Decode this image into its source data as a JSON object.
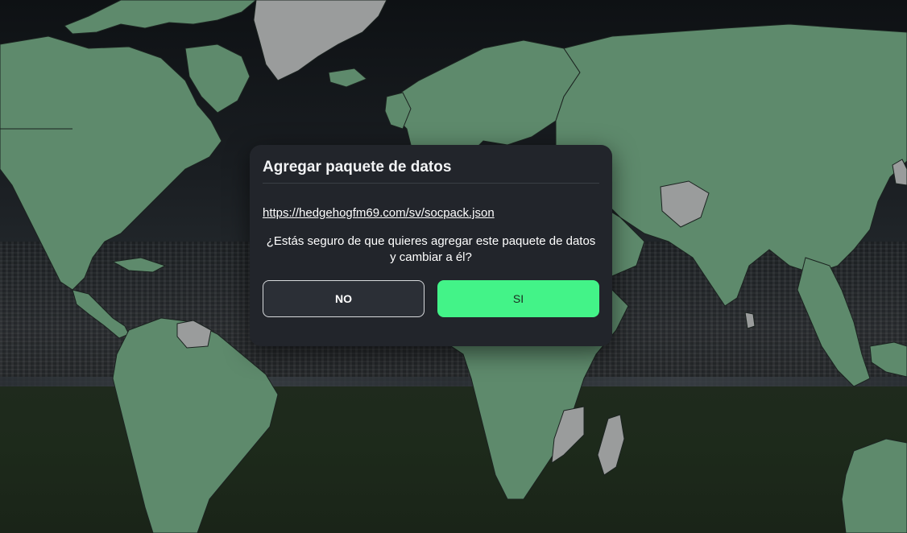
{
  "dialog": {
    "title": "Agregar paquete de datos",
    "url": "https://hedgehogfm69.com/sv/socpack.json",
    "question": "¿Estás seguro de que quieres agregar este paquete de datos y cambiar a él?",
    "no_label": "NO",
    "yes_label": "SI"
  },
  "colors": {
    "land": "#5e8a6c",
    "land_unavailable": "#9a9c9c",
    "modal_bg": "#22252b",
    "accent": "#43f388"
  }
}
